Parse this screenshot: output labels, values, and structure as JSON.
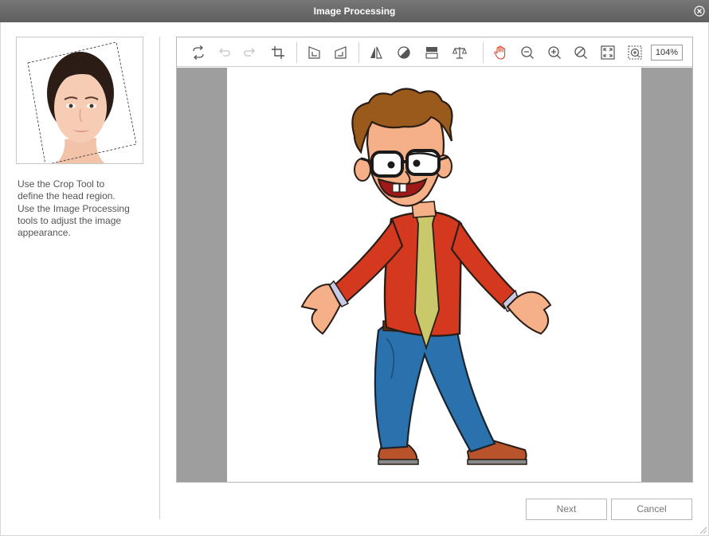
{
  "window": {
    "title": "Image Processing"
  },
  "sidebar": {
    "instructions": [
      "Use the Crop Tool to",
      "define the head region.",
      "Use the Image Processing",
      "tools to adjust the image",
      "appearance."
    ]
  },
  "toolbar": {
    "tools": [
      {
        "name": "rotate-icon",
        "enabled": true
      },
      {
        "name": "undo-icon",
        "enabled": false
      },
      {
        "name": "redo-icon",
        "enabled": false
      },
      {
        "name": "crop-icon",
        "enabled": true
      },
      {
        "name": "rotate-left-icon",
        "enabled": true
      },
      {
        "name": "rotate-right-icon",
        "enabled": true
      },
      {
        "name": "flip-icon",
        "enabled": true
      },
      {
        "name": "contrast-icon",
        "enabled": true
      },
      {
        "name": "levels-icon",
        "enabled": true
      },
      {
        "name": "balance-icon",
        "enabled": true
      },
      {
        "name": "hand-icon",
        "enabled": true,
        "active": true
      },
      {
        "name": "zoom-out-icon",
        "enabled": true
      },
      {
        "name": "zoom-in-icon",
        "enabled": true
      },
      {
        "name": "zoom-reset-icon",
        "enabled": true
      },
      {
        "name": "fit-screen-icon",
        "enabled": true
      },
      {
        "name": "fit-selection-icon",
        "enabled": true
      }
    ],
    "zoom_level": "104%"
  },
  "buttons": {
    "next": "Next",
    "cancel": "Cancel"
  },
  "colors": {
    "titlebar": "#6a6a6a",
    "canvas_bg": "#9e9e9e",
    "active_tool": "#e0442c",
    "shirt": "#d4391f",
    "tie": "#c9c86a",
    "jeans": "#2a72ad",
    "hair": "#9a5a1c"
  }
}
